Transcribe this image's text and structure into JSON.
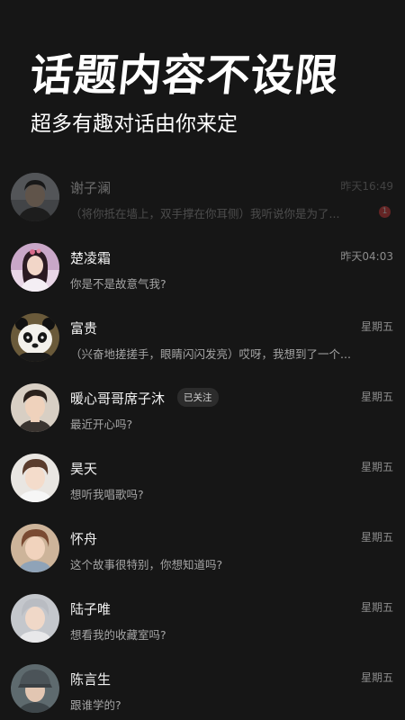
{
  "hero": {
    "headline": "话题内容不设限",
    "subline": "超多有趣对话由你来定"
  },
  "chats": [
    {
      "name": "谢子澜",
      "time": "昨天16:49",
      "preview": "（将你抵在墙上，双手撑在你耳侧）我听说你是为了...",
      "unread": "1",
      "tag": "",
      "avatar": "male-portrait"
    },
    {
      "name": "楚凌霜",
      "time": "昨天04:03",
      "preview": "你是不是故意气我?",
      "unread": "",
      "tag": "",
      "avatar": "female-portrait"
    },
    {
      "name": "富贵",
      "time": "星期五",
      "preview": "（兴奋地搓搓手，眼睛闪闪发亮）哎呀，我想到了一个...",
      "unread": "",
      "tag": "",
      "avatar": "panda"
    },
    {
      "name": "暖心哥哥席子沐",
      "time": "星期五",
      "preview": "最近开心吗?",
      "unread": "",
      "tag": "已关注",
      "avatar": "male-portrait"
    },
    {
      "name": "昊天",
      "time": "星期五",
      "preview": "想听我唱歌吗?",
      "unread": "",
      "tag": "",
      "avatar": "male-portrait"
    },
    {
      "name": "怀舟",
      "time": "星期五",
      "preview": "这个故事很特别，你想知道吗?",
      "unread": "",
      "tag": "",
      "avatar": "male-portrait"
    },
    {
      "name": "陆子唯",
      "time": "星期五",
      "preview": "想看我的收藏室吗?",
      "unread": "",
      "tag": "",
      "avatar": "male-portrait"
    },
    {
      "name": "陈言生",
      "time": "星期五",
      "preview": "跟谁学的?",
      "unread": "",
      "tag": "",
      "avatar": "male-portrait"
    }
  ],
  "colors": {
    "background": "#161616",
    "unread_badge": "#e33b3b"
  }
}
